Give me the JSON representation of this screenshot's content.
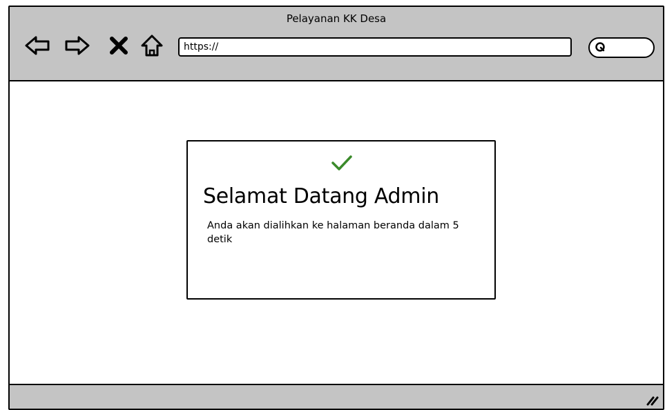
{
  "window": {
    "title": "Pelayanan KK Desa",
    "url": "https://"
  },
  "toolbar": {
    "back_icon": "back-arrow-icon",
    "forward_icon": "forward-arrow-icon",
    "close_icon": "close-x-icon",
    "home_icon": "home-icon",
    "search_icon": "search-icon"
  },
  "dialog": {
    "icon": "checkmark-icon",
    "icon_color": "#3a8a2a",
    "heading": "Selamat Datang Admin",
    "message": "Anda akan dialihkan ke halaman beranda dalam 5 detik"
  },
  "colors": {
    "chrome": "#c4c4c4",
    "border": "#000000",
    "background": "#ffffff"
  }
}
